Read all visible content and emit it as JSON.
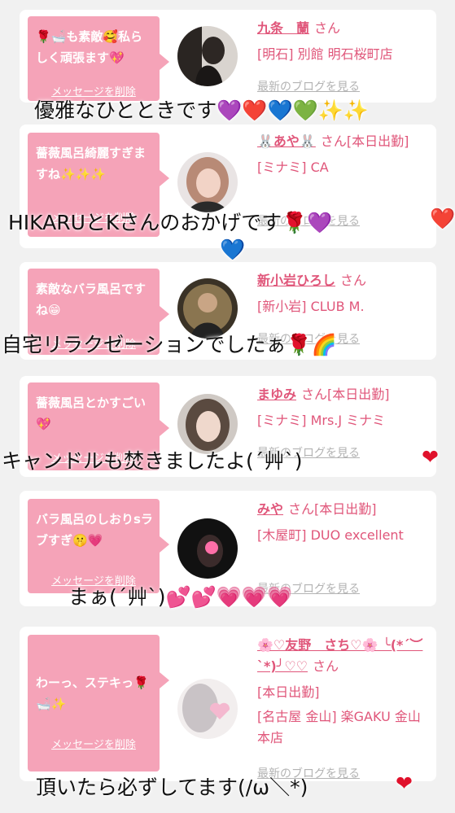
{
  "cards": [
    {
      "message": "🌹🛁も素敵🥰私らしく頑張ます💖",
      "delete_label": "メッセージを削除",
      "name": "九条　蘭",
      "suffix": "さん",
      "shop": "[明石] 別館 明石桜町店",
      "blog_label": "最新のブログを見る"
    },
    {
      "message": "薔薇風呂綺麗すぎますね✨✨✨",
      "delete_label": "メッセージを削除",
      "name": "🐰あや🐰",
      "suffix": "さん[本日出勤]",
      "shop": "[ミナミ] CA",
      "blog_label": "最新のブログを見る"
    },
    {
      "message": "素敵なバラ風呂ですね😁",
      "delete_label": "メッセージを削除",
      "name": "新小岩ひろし",
      "suffix": "さん",
      "shop": "[新小岩] CLUB M.",
      "blog_label": "最新のブログを見る"
    },
    {
      "message": "薔薇風呂とかすごい💖",
      "delete_label": "メッセージを削除",
      "name": "まゆみ",
      "suffix": "さん[本日出勤]",
      "shop": "[ミナミ] Mrs.J ミナミ",
      "blog_label": "最新のブログを見る"
    },
    {
      "message": "バラ風呂のしおりsラブすぎ🤫💗",
      "delete_label": "メッセージを削除",
      "name": "みや",
      "suffix": "さん[本日出勤]",
      "shop": "[木屋町] DUO excellent",
      "blog_label": "最新のブログを見る"
    },
    {
      "message": "わーっ、ステキっ🌹🛁✨",
      "delete_label": "メッセージを削除",
      "name": "🌸♡友野　さち♡🌸 ╰(*´︶`*)╯♡♡",
      "suffix": "さん",
      "shop": "[本日出勤]",
      "shop2": "[名古屋 金山] 楽GAKU 金山本店",
      "blog_label": "最新のブログを見る"
    }
  ],
  "overlays": [
    "優雅なひとときです💜❤️💙💚✨✨",
    "HIKARUとKさんのおかげです🌹💜",
    "💙",
    "自宅リラクゼーションでしたぁ🌹🌈",
    "キャンドルも焚きましたよ(´艸`)",
    "まぁ(´艸`)💕💕💗💗💗",
    "頂いたら必ずしてます(/ω＼*)"
  ],
  "overlay_hearts": [
    "❤️",
    "❤",
    "❤"
  ],
  "colors": {
    "accent": "#e0567a",
    "bubble": "#f5a3b8",
    "background": "#f1f1f1"
  }
}
